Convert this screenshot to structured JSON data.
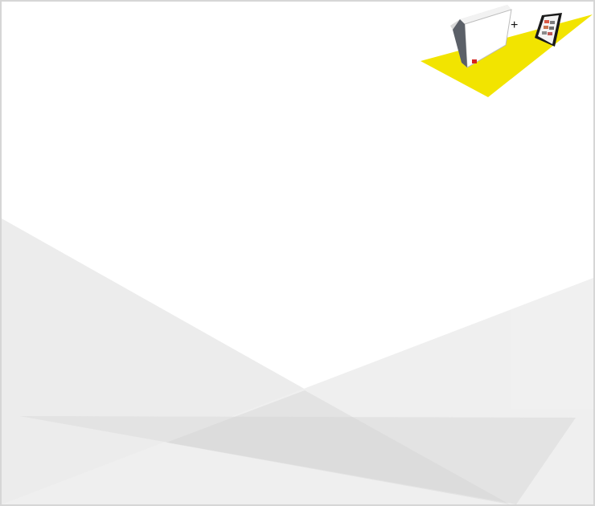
{
  "page": {
    "title": ""
  },
  "promo": {
    "plus_text": "+",
    "product_box_icon": "product-box-icon",
    "tablet_icon": "tablet-icon",
    "accent_color": "#f2e400"
  },
  "background": {
    "colors": [
      "#ececec",
      "#efefef",
      "#e2e2e2",
      "#d3d3d3"
    ]
  }
}
